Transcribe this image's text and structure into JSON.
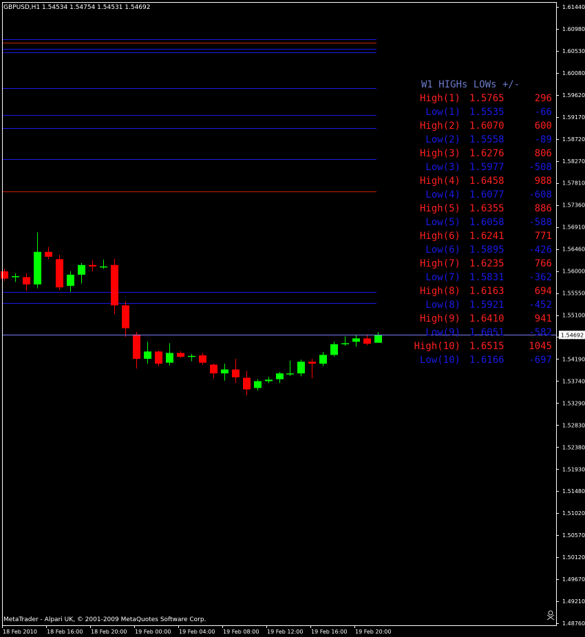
{
  "chart_data": {
    "type": "candlestick",
    "title": "GBPUSD,H1  1.54534 1.54754 1.54531 1.54692",
    "current_price": "1.54692",
    "colors": {
      "background": "#000000",
      "bull": "#00ff00",
      "bear": "#ff0000",
      "axis": "#ffffff",
      "high_text": "#ff2020",
      "low_text": "#1a1ae6",
      "header_text": "#6a7ac8",
      "high_line": "#cc2200",
      "low_line": "#1a1ae6",
      "price_line": "#8080ff"
    },
    "y_ticks": [
      "1.61440",
      "1.60980",
      "1.60530",
      "1.60080",
      "1.59620",
      "1.59170",
      "1.58720",
      "1.58270",
      "1.57810",
      "1.57360",
      "1.56910",
      "1.56460",
      "1.56000",
      "1.55550",
      "1.55100",
      "1.54650",
      "1.54190",
      "1.53740",
      "1.53290",
      "1.52830",
      "1.52380",
      "1.51930",
      "1.51480",
      "1.51020",
      "1.50570",
      "1.50120",
      "1.49670",
      "1.49210",
      "1.48760"
    ],
    "ylim": [
      1.4876,
      1.6144
    ],
    "x_ticks": [
      "18 Feb 2010",
      "18 Feb 16:00",
      "18 Feb 20:00",
      "19 Feb 00:00",
      "19 Feb 04:00",
      "19 Feb 08:00",
      "19 Feb 12:00",
      "19 Feb 16:00",
      "19 Feb 20:00"
    ],
    "candles": [
      {
        "o": 1.56,
        "h": 1.5605,
        "l": 1.558,
        "c": 1.5585
      },
      {
        "o": 1.559,
        "h": 1.5596,
        "l": 1.5578,
        "c": 1.559
      },
      {
        "o": 1.5588,
        "h": 1.5596,
        "l": 1.556,
        "c": 1.5573
      },
      {
        "o": 1.5573,
        "h": 1.568,
        "l": 1.5565,
        "c": 1.564
      },
      {
        "o": 1.564,
        "h": 1.565,
        "l": 1.5625,
        "c": 1.563
      },
      {
        "o": 1.5625,
        "h": 1.5634,
        "l": 1.5562,
        "c": 1.5567
      },
      {
        "o": 1.557,
        "h": 1.56,
        "l": 1.5558,
        "c": 1.5593
      },
      {
        "o": 1.5593,
        "h": 1.5617,
        "l": 1.5575,
        "c": 1.5613
      },
      {
        "o": 1.5613,
        "h": 1.5623,
        "l": 1.56,
        "c": 1.561
      },
      {
        "o": 1.561,
        "h": 1.5624,
        "l": 1.5605,
        "c": 1.561
      },
      {
        "o": 1.5613,
        "h": 1.5626,
        "l": 1.5512,
        "c": 1.553
      },
      {
        "o": 1.553,
        "h": 1.5538,
        "l": 1.5465,
        "c": 1.5483
      },
      {
        "o": 1.547,
        "h": 1.5475,
        "l": 1.54,
        "c": 1.542
      },
      {
        "o": 1.542,
        "h": 1.5455,
        "l": 1.541,
        "c": 1.5435
      },
      {
        "o": 1.5435,
        "h": 1.5437,
        "l": 1.5405,
        "c": 1.541
      },
      {
        "o": 1.5412,
        "h": 1.5452,
        "l": 1.5406,
        "c": 1.5432
      },
      {
        "o": 1.5432,
        "h": 1.5436,
        "l": 1.5422,
        "c": 1.5424
      },
      {
        "o": 1.5426,
        "h": 1.543,
        "l": 1.5415,
        "c": 1.5426
      },
      {
        "o": 1.5427,
        "h": 1.5432,
        "l": 1.5408,
        "c": 1.5412
      },
      {
        "o": 1.5408,
        "h": 1.541,
        "l": 1.538,
        "c": 1.539
      },
      {
        "o": 1.539,
        "h": 1.541,
        "l": 1.5375,
        "c": 1.5398
      },
      {
        "o": 1.5398,
        "h": 1.542,
        "l": 1.537,
        "c": 1.5382
      },
      {
        "o": 1.5381,
        "h": 1.5395,
        "l": 1.5345,
        "c": 1.5357
      },
      {
        "o": 1.536,
        "h": 1.5378,
        "l": 1.5355,
        "c": 1.5374
      },
      {
        "o": 1.5374,
        "h": 1.5383,
        "l": 1.537,
        "c": 1.5377
      },
      {
        "o": 1.5378,
        "h": 1.5393,
        "l": 1.537,
        "c": 1.539
      },
      {
        "o": 1.539,
        "h": 1.5416,
        "l": 1.5385,
        "c": 1.539
      },
      {
        "o": 1.539,
        "h": 1.5418,
        "l": 1.5384,
        "c": 1.5414
      },
      {
        "o": 1.5414,
        "h": 1.542,
        "l": 1.538,
        "c": 1.541
      },
      {
        "o": 1.541,
        "h": 1.5434,
        "l": 1.5405,
        "c": 1.5428
      },
      {
        "o": 1.5428,
        "h": 1.5455,
        "l": 1.5425,
        "c": 1.545
      },
      {
        "o": 1.545,
        "h": 1.5466,
        "l": 1.5447,
        "c": 1.5452
      },
      {
        "o": 1.5455,
        "h": 1.547,
        "l": 1.5445,
        "c": 1.5462
      },
      {
        "o": 1.5462,
        "h": 1.547,
        "l": 1.5448,
        "c": 1.5451
      },
      {
        "o": 1.5453,
        "h": 1.5475,
        "l": 1.5453,
        "c": 1.5469
      }
    ],
    "level_lines": [
      {
        "kind": "low",
        "price": 1.6077
      },
      {
        "kind": "high",
        "price": 1.607
      },
      {
        "kind": "low",
        "price": 1.6058
      },
      {
        "kind": "low",
        "price": 1.6051
      },
      {
        "kind": "low",
        "price": 1.5977
      },
      {
        "kind": "low",
        "price": 1.5921
      },
      {
        "kind": "low",
        "price": 1.5895
      },
      {
        "kind": "low",
        "price": 1.5831
      },
      {
        "kind": "high",
        "price": 1.5765
      },
      {
        "kind": "low",
        "price": 1.5558
      },
      {
        "kind": "low",
        "price": 1.5535
      }
    ],
    "annotation": {
      "header": "W1 HIGHs LOWs +/-",
      "rows": [
        {
          "label": "High(1)",
          "price": "1.5765",
          "diff": "296",
          "kind": "high"
        },
        {
          "label": "Low(1)",
          "price": "1.5535",
          "diff": "-66",
          "kind": "low"
        },
        {
          "label": "High(2)",
          "price": "1.6070",
          "diff": "600",
          "kind": "high"
        },
        {
          "label": "Low(2)",
          "price": "1.5558",
          "diff": "-89",
          "kind": "low"
        },
        {
          "label": "High(3)",
          "price": "1.6276",
          "diff": "806",
          "kind": "high"
        },
        {
          "label": "Low(3)",
          "price": "1.5977",
          "diff": "-508",
          "kind": "low"
        },
        {
          "label": "High(4)",
          "price": "1.6458",
          "diff": "988",
          "kind": "high"
        },
        {
          "label": "Low(4)",
          "price": "1.6077",
          "diff": "-608",
          "kind": "low"
        },
        {
          "label": "High(5)",
          "price": "1.6355",
          "diff": "886",
          "kind": "high"
        },
        {
          "label": "Low(5)",
          "price": "1.6058",
          "diff": "-588",
          "kind": "low"
        },
        {
          "label": "High(6)",
          "price": "1.6241",
          "diff": "771",
          "kind": "high"
        },
        {
          "label": "Low(6)",
          "price": "1.5895",
          "diff": "-426",
          "kind": "low"
        },
        {
          "label": "High(7)",
          "price": "1.6235",
          "diff": "766",
          "kind": "high"
        },
        {
          "label": "Low(7)",
          "price": "1.5831",
          "diff": "-362",
          "kind": "low"
        },
        {
          "label": "High(8)",
          "price": "1.6163",
          "diff": "694",
          "kind": "high"
        },
        {
          "label": "Low(8)",
          "price": "1.5921",
          "diff": "-452",
          "kind": "low"
        },
        {
          "label": "High(9)",
          "price": "1.6410",
          "diff": "941",
          "kind": "high"
        },
        {
          "label": "Low(9)",
          "price": "1.6051",
          "diff": "-582",
          "kind": "low"
        },
        {
          "label": "High(10)",
          "price": "1.6515",
          "diff": "1045",
          "kind": "high"
        },
        {
          "label": "Low(10)",
          "price": "1.6166",
          "diff": "-697",
          "kind": "low"
        }
      ]
    }
  },
  "footer": {
    "copyright": "MetaTrader - Alpari UK, © 2001-2009 MetaQuotes Software Corp.",
    "icon": "skull-crossbones-icon"
  }
}
